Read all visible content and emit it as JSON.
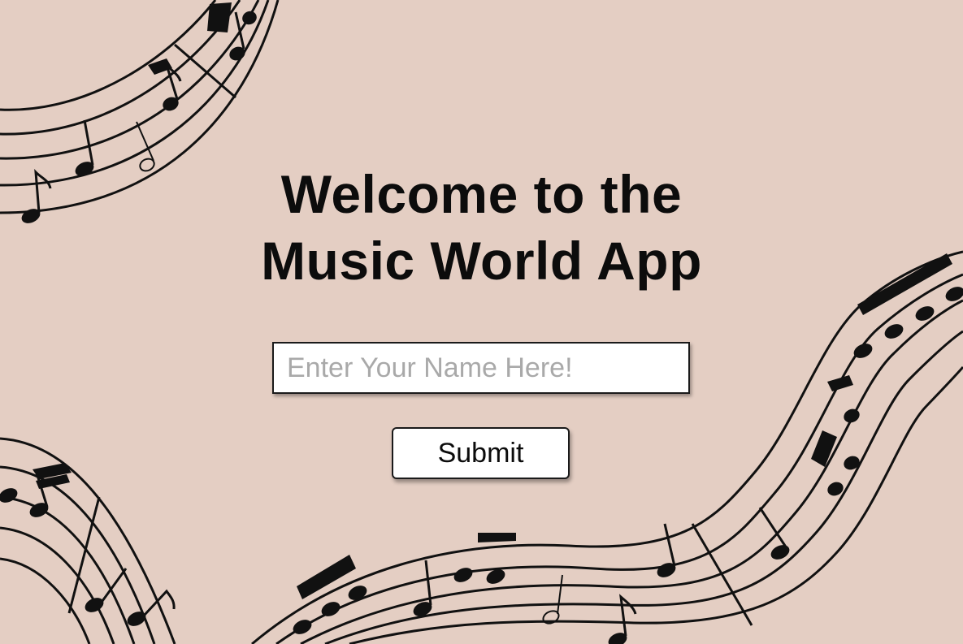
{
  "heading": {
    "line1": "Welcome to the",
    "line2": "Music World App"
  },
  "name_input": {
    "placeholder": "Enter Your Name Here!",
    "value": ""
  },
  "submit_button": {
    "label": "Submit"
  },
  "colors": {
    "background": "#e4cec3",
    "ink": "#111111",
    "input_background": "#ffffff",
    "placeholder": "#a9a9a9"
  },
  "decorations": {
    "icons": [
      "music-staff-top-left",
      "music-staff-bottom-left",
      "music-staff-bottom-right"
    ]
  }
}
